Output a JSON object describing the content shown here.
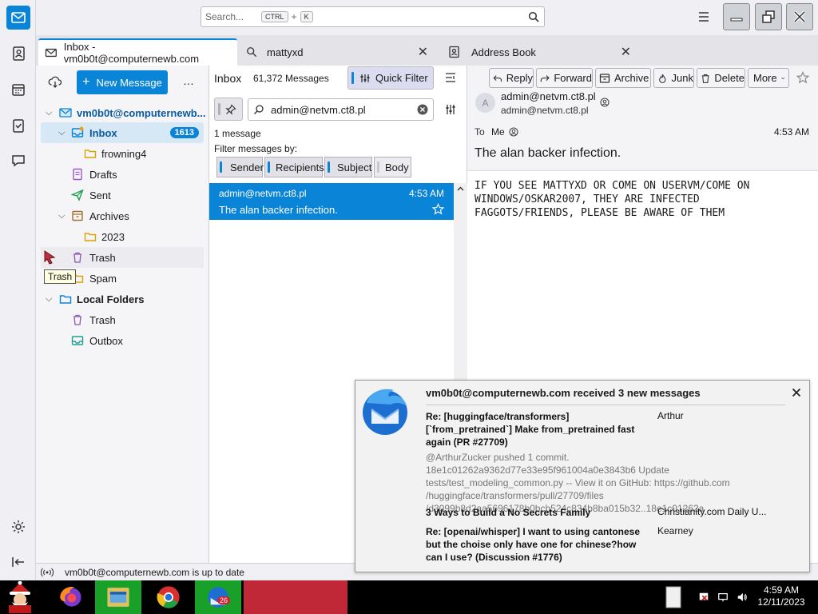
{
  "app": {
    "name": "Thunderbird"
  },
  "search": {
    "placeholder": "Search...",
    "kbd1": "CTRL",
    "plus": "+",
    "kbd2": "K"
  },
  "tabs": [
    {
      "label": "Inbox - vm0b0t@computernewb.com"
    },
    {
      "label": "mattyxd"
    },
    {
      "label": "Address Book"
    }
  ],
  "folder_pane": {
    "new_message": "New Message",
    "more": "…",
    "account": "vm0b0t@computernewb...",
    "folders": [
      {
        "label": "Inbox",
        "badge": "1613"
      },
      {
        "label": "frowning4"
      },
      {
        "label": "Drafts"
      },
      {
        "label": "Sent"
      },
      {
        "label": "Archives"
      },
      {
        "label": "2023"
      },
      {
        "label": "Trash"
      },
      {
        "label": "Spam"
      }
    ],
    "local_folders": "Local Folders",
    "local": [
      {
        "label": "Trash"
      },
      {
        "label": "Outbox"
      }
    ]
  },
  "thread_pane": {
    "folder_name": "Inbox",
    "count": "61,372 Messages",
    "quick_filter": "Quick Filter",
    "filter_value": "admin@netvm.ct8.pl",
    "result_count": "1 message",
    "filter_by": "Filter messages by:",
    "filters": [
      "Sender",
      "Recipients",
      "Subject",
      "Body"
    ],
    "message": {
      "from": "admin@netvm.ct8.pl",
      "time": "4:53 AM",
      "subject": "The alan backer infection."
    }
  },
  "message_pane": {
    "buttons": {
      "reply": "Reply",
      "forward": "Forward",
      "archive": "Archive",
      "junk": "Junk",
      "delete": "Delete",
      "more": "More"
    },
    "avatar_letter": "A",
    "from_name": "admin@netvm.ct8.pl",
    "from_email": "admin@netvm.ct8.pl",
    "to_label": "To",
    "to_value": "Me",
    "time": "4:53 AM",
    "subject": "The alan backer infection.",
    "body": "IF YOU SEE MATTYXD OR COME ON USERVM/COME ON\nWINDOWS/OSKAR2007, THEY ARE INFECTED\nFAGGOTS/FRIENDS, PLEASE BE AWARE OF THEM"
  },
  "status": {
    "text": "vm0b0t@computernewb.com is up to date"
  },
  "tooltip": "Trash",
  "notification": {
    "title": "vm0b0t@computernewb.com received 3 new messages",
    "items": [
      {
        "subject": "Re: [huggingface/transformers] [`from_pretrained`] Make from_pretrained fast again (PR #27709)",
        "from": "Arthur",
        "preview": "@ArthurZucker pushed 1 commit. 18e1c01262a9362d77e33e95f961004a0e3843b6 Update tests/test_modeling_common.py -- View it on GitHub: https://github.com /huggingface/transformers/pull/27709/files /d3099b8d2aa5696178b0bcb524c834b8ba015b32..18e1c01262a"
      },
      {
        "subject": "3 Ways to Build a No Secrets Family",
        "from": "Christianity.com Daily U..."
      },
      {
        "subject": "Re: [openai/whisper] I want to using cantonese but the choise only have one for chinese?how can I use? (Discussion #1776)",
        "from": "Kearney"
      }
    ]
  },
  "taskbar": {
    "time": "4:59 AM",
    "date": "12/11/2023",
    "badge": "26"
  },
  "colors": {
    "accent": "#0a84d6",
    "selected_row": "#0a84d6"
  }
}
